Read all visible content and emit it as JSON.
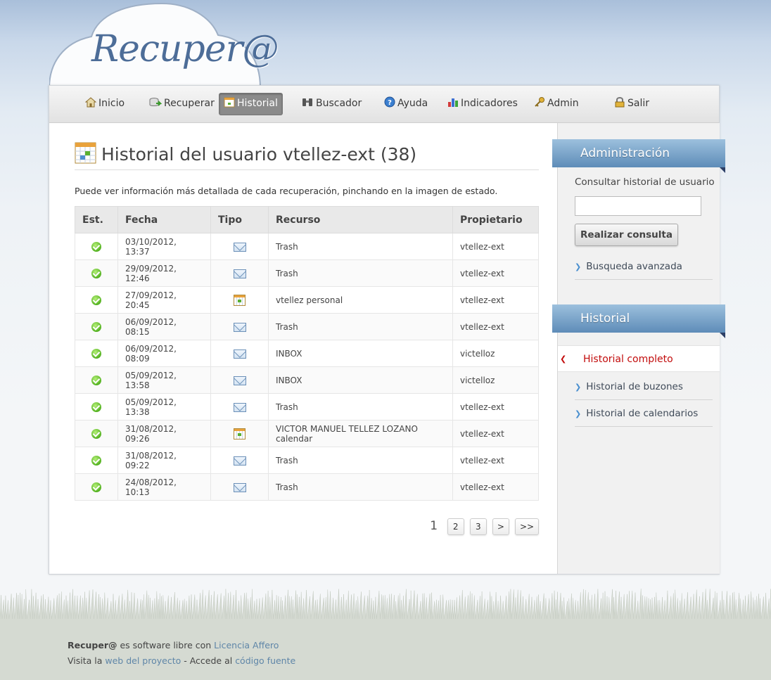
{
  "header": {
    "logo_text": "Recuper@"
  },
  "nav": [
    {
      "label": "Inicio",
      "icon": "home-icon"
    },
    {
      "label": "Recuperar",
      "icon": "restore-icon"
    },
    {
      "label": "Historial",
      "icon": "calendar-icon",
      "active": true
    },
    {
      "label": "Buscador",
      "icon": "binoculars-icon"
    },
    {
      "label": "Ayuda",
      "icon": "help-icon"
    },
    {
      "label": "Indicadores",
      "icon": "chart-icon"
    },
    {
      "label": "Admin",
      "icon": "key-icon"
    },
    {
      "label": "Salir",
      "icon": "lock-icon"
    }
  ],
  "main": {
    "title": "Historial del usuario vtellez-ext (38)",
    "intro": "Puede ver información más detallada de cada recuperación, pinchando en la imagen de estado.",
    "columns": [
      "Est.",
      "Fecha",
      "Tipo",
      "Recurso",
      "Propietario"
    ],
    "rows": [
      {
        "estado": "ok",
        "fecha": "03/10/2012, 13:37",
        "tipo": "mail",
        "recurso": "Trash",
        "propietario": "vtellez-ext"
      },
      {
        "estado": "ok",
        "fecha": "29/09/2012, 12:46",
        "tipo": "mail",
        "recurso": "Trash",
        "propietario": "vtellez-ext"
      },
      {
        "estado": "ok",
        "fecha": "27/09/2012, 20:45",
        "tipo": "calendar",
        "recurso": "vtellez personal",
        "propietario": "vtellez-ext"
      },
      {
        "estado": "ok",
        "fecha": "06/09/2012, 08:15",
        "tipo": "mail",
        "recurso": "Trash",
        "propietario": "vtellez-ext"
      },
      {
        "estado": "ok",
        "fecha": "06/09/2012, 08:09",
        "tipo": "mail",
        "recurso": "INBOX",
        "propietario": "victelloz"
      },
      {
        "estado": "ok",
        "fecha": "05/09/2012, 13:58",
        "tipo": "mail",
        "recurso": "INBOX",
        "propietario": "victelloz"
      },
      {
        "estado": "ok",
        "fecha": "05/09/2012, 13:38",
        "tipo": "mail",
        "recurso": "Trash",
        "propietario": "vtellez-ext"
      },
      {
        "estado": "ok",
        "fecha": "31/08/2012, 09:26",
        "tipo": "calendar",
        "recurso": "VICTOR MANUEL TELLEZ LOZANO calendar",
        "propietario": "vtellez-ext"
      },
      {
        "estado": "ok",
        "fecha": "31/08/2012, 09:22",
        "tipo": "mail",
        "recurso": "Trash",
        "propietario": "vtellez-ext"
      },
      {
        "estado": "ok",
        "fecha": "24/08/2012, 10:13",
        "tipo": "mail",
        "recurso": "Trash",
        "propietario": "vtellez-ext"
      }
    ],
    "pager": {
      "current": "1",
      "pages": [
        "2",
        "3"
      ],
      "next": ">",
      "last": ">>"
    }
  },
  "sidebar": {
    "admin_title": "Administración",
    "admin_label": "Consultar historial de usuario",
    "search_value": "",
    "search_button": "Realizar consulta",
    "advanced_link": "Busqueda avanzada",
    "historial_title": "Historial",
    "historial_links": [
      "Historial completo",
      "Historial de buzones",
      "Historial de calendarios"
    ]
  },
  "footer": {
    "line1_brand": "Recuper@",
    "line1_text": " es software libre con ",
    "line1_link": "Licencia Affero",
    "line2_text1": "Visita la ",
    "line2_link1": "web del proyecto",
    "line2_text2": " - Accede al ",
    "line2_link2": "código fuente"
  },
  "colors": {
    "accent_blue": "#5e8cb8",
    "active_link": "#c20c0c",
    "status_ok": "#53b21f",
    "link": "#5f86a8"
  }
}
